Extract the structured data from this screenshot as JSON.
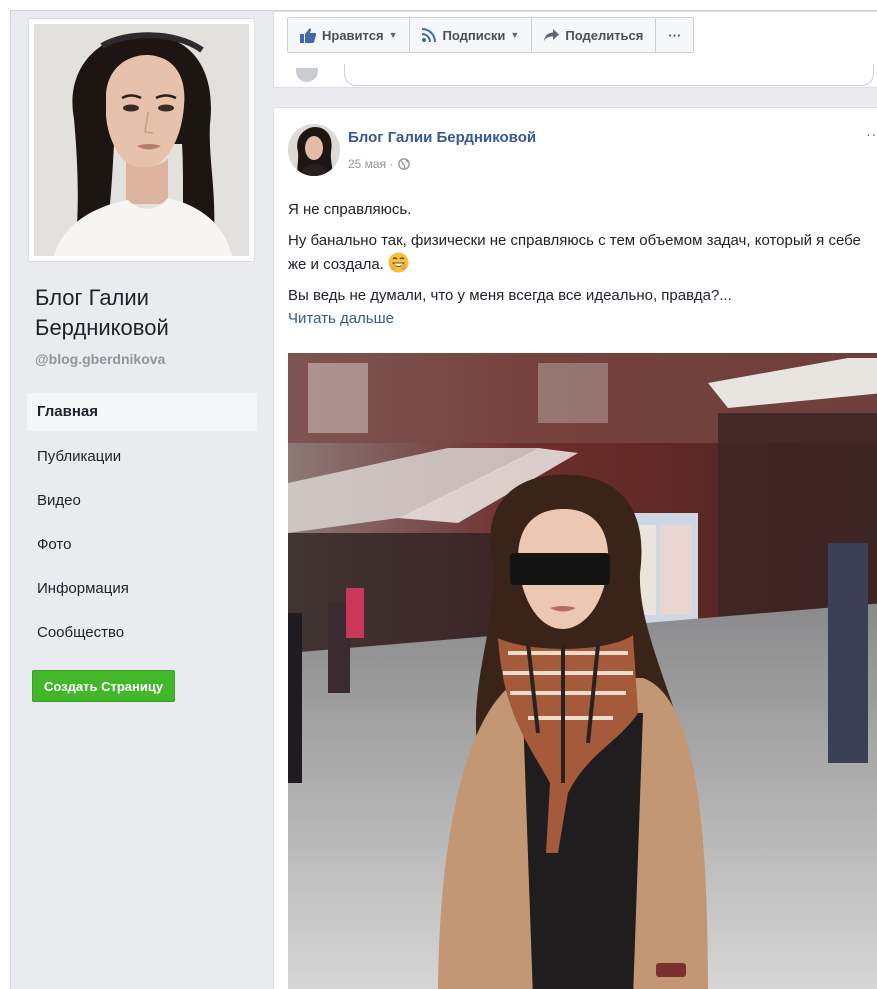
{
  "sidebar": {
    "page_name": "Блог Галии Бердниковой",
    "handle": "@blog.gberdnikova",
    "nav": [
      {
        "label": "Главная",
        "active": true
      },
      {
        "label": "Публикации"
      },
      {
        "label": "Видео"
      },
      {
        "label": "Фото"
      },
      {
        "label": "Информация"
      },
      {
        "label": "Сообщество"
      }
    ],
    "create_button": "Создать Страницу"
  },
  "topbar": {
    "like_label": "Нравится",
    "follow_label": "Подписки",
    "share_label": "Поделиться",
    "more_label": "···"
  },
  "post": {
    "author": "Блог Галии Бердниковой",
    "date": "25 мая",
    "more": "···",
    "para1": "Я не справляюсь.",
    "para2": "Ну банально так, физически не справляюсь с тем объемом задач, который я себе же и создала.",
    "para3": "Вы ведь не думали, что у меня всегда все идеально, правда?...",
    "read_more": "Читать дальше"
  },
  "colors": {
    "link": "#365899",
    "create_green": "#42b72a",
    "background": "#e9ebee"
  },
  "icons": [
    "thumbs-up-icon",
    "rss-icon",
    "share-arrow-icon",
    "globe-icon",
    "grinning-emoji-icon"
  ]
}
